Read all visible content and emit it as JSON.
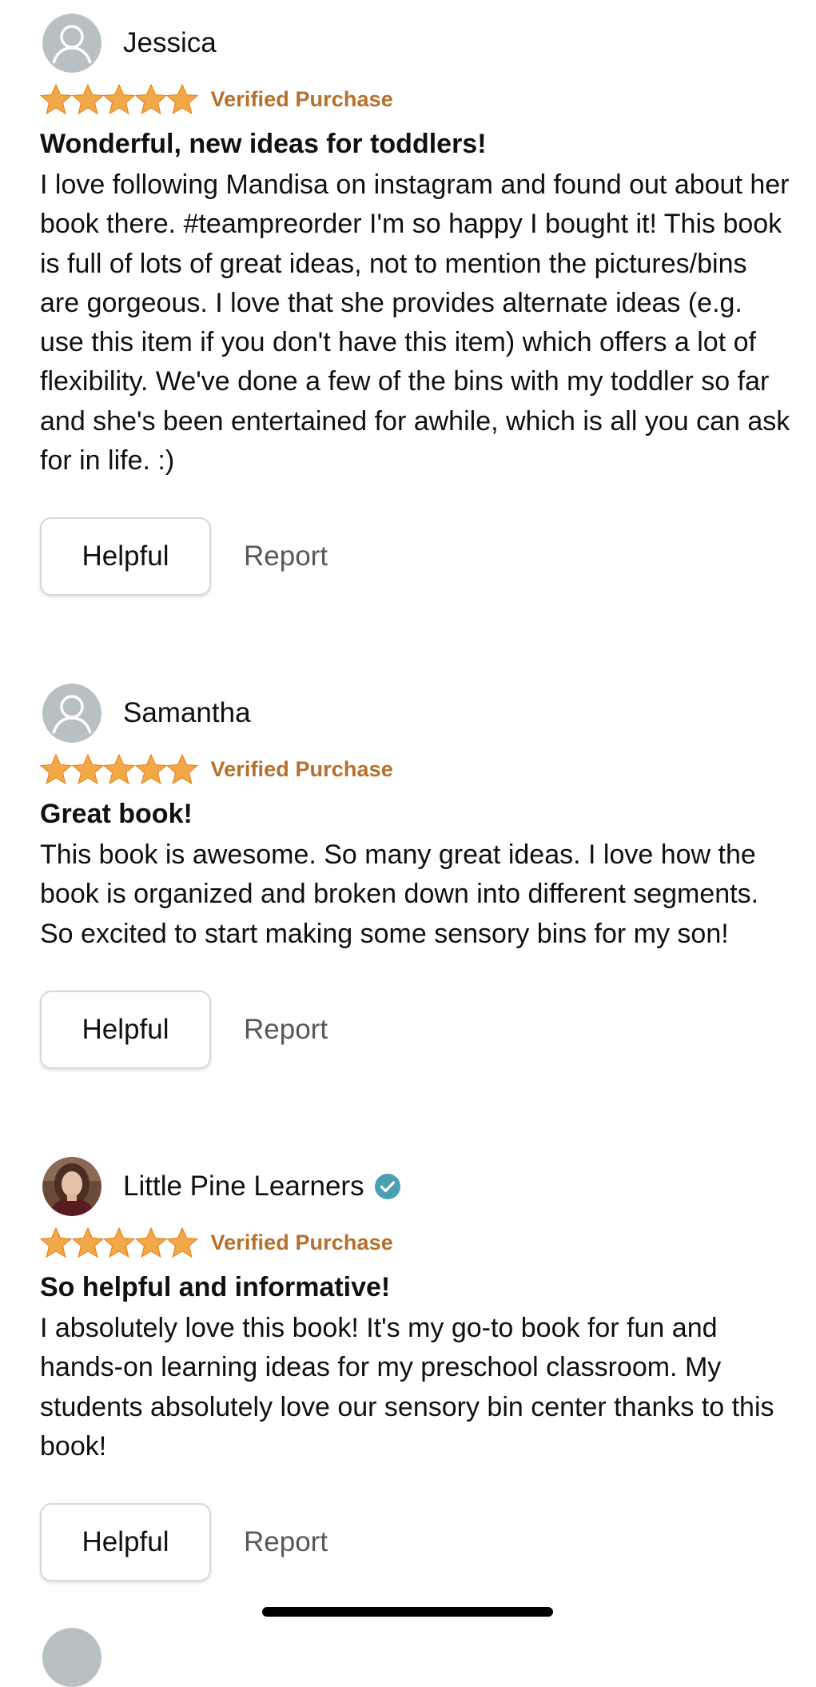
{
  "reviews": [
    {
      "reviewer": "Jessica",
      "avatar_icon": "default-user-icon",
      "verified_reviewer": false,
      "rating": 5,
      "badge": "Verified Purchase",
      "title": "Wonderful, new ideas for toddlers!",
      "body": "I love following Mandisa on instagram and found out about her book there. #teampreorder I'm so happy I bought it! This book is full of lots of great ideas, not to mention the pictures/bins are gorgeous. I love that she provides alternate ideas (e.g. use this item if you don't have this item) which offers a lot of flexibility. We've done a few of the bins with my toddler so far and she's been entertained for awhile, which is all you can ask for in life. :)",
      "helpful_label": "Helpful",
      "report_label": "Report"
    },
    {
      "reviewer": "Samantha",
      "avatar_icon": "default-user-icon",
      "verified_reviewer": false,
      "rating": 5,
      "badge": "Verified Purchase",
      "title": "Great book!",
      "body": "This book is awesome. So many great ideas. I love how the book is organized and broken down into different segments. So excited to start making some sensory bins for my son!",
      "helpful_label": "Helpful",
      "report_label": "Report"
    },
    {
      "reviewer": "Little Pine Learners",
      "avatar_icon": "profile-photo",
      "verified_reviewer": true,
      "verified_icon": "check-badge-icon",
      "rating": 5,
      "badge": "Verified Purchase",
      "title": "So helpful and informative!",
      "body": "I absolutely love this book! It's my go-to book for fun and hands-on learning ideas for my preschool classroom. My students absolutely love our sensory bin center thanks to this book!",
      "helpful_label": "Helpful",
      "report_label": "Report"
    }
  ],
  "colors": {
    "star": "#f3a847",
    "verified_purchase": "#b5702c",
    "verified_badge": "#4a9fb5",
    "avatar_placeholder": "#b8c0c4"
  }
}
